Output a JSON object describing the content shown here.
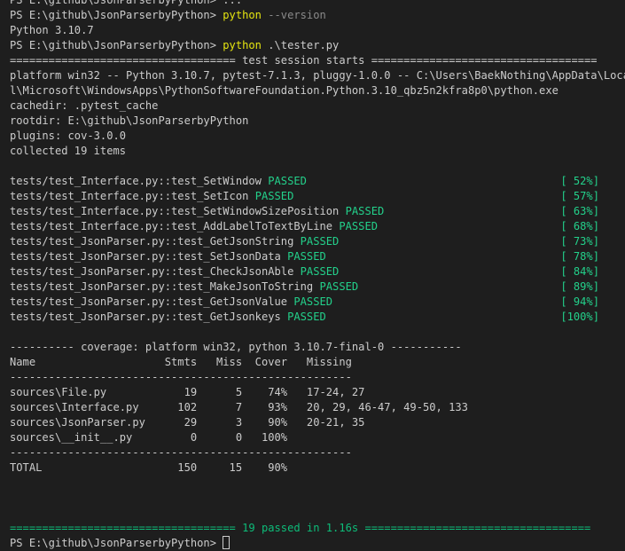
{
  "terminal": {
    "partial_top": "PS E:\\github\\JsonParserbyPython> ...",
    "cmd1": {
      "prompt": "PS E:\\github\\JsonParserbyPython> ",
      "exe": "python",
      "args": " --version"
    },
    "version_output": "Python 3.10.7",
    "cmd2": {
      "prompt": "PS E:\\github\\JsonParserbyPython> ",
      "exe": "python",
      "args": " .\\tester.py"
    },
    "session_header": "=================================== test session starts ===================================",
    "platform_line1": "platform win32 -- Python 3.10.7, pytest-7.1.3, pluggy-1.0.0 -- C:\\Users\\BaekNothing\\AppData\\Local",
    "platform_line2": "l\\Microsoft\\WindowsApps\\PythonSoftwareFoundation.Python.3.10_qbz5n2kfra8p0\\python.exe",
    "cachedir": "cachedir: .pytest_cache",
    "rootdir": "rootdir: E:\\github\\JsonParserbyPython",
    "plugins": "plugins: cov-3.0.0",
    "collected": "collected 19 items",
    "tests": [
      {
        "name": "tests/test_Interface.py::test_SetWindow",
        "status": "PASSED",
        "pct": "[ 52%]"
      },
      {
        "name": "tests/test_Interface.py::test_SetIcon",
        "status": "PASSED",
        "pct": "[ 57%]"
      },
      {
        "name": "tests/test_Interface.py::test_SetWindowSizePosition",
        "status": "PASSED",
        "pct": "[ 63%]"
      },
      {
        "name": "tests/test_Interface.py::test_AddLabelToTextByLine",
        "status": "PASSED",
        "pct": "[ 68%]"
      },
      {
        "name": "tests/test_JsonParser.py::test_GetJsonString",
        "status": "PASSED",
        "pct": "[ 73%]"
      },
      {
        "name": "tests/test_JsonParser.py::test_SetJsonData",
        "status": "PASSED",
        "pct": "[ 78%]"
      },
      {
        "name": "tests/test_JsonParser.py::test_CheckJsonAble",
        "status": "PASSED",
        "pct": "[ 84%]"
      },
      {
        "name": "tests/test_JsonParser.py::test_MakeJsonToString",
        "status": "PASSED",
        "pct": "[ 89%]"
      },
      {
        "name": "tests/test_JsonParser.py::test_GetJsonValue",
        "status": "PASSED",
        "pct": "[ 94%]"
      },
      {
        "name": "tests/test_JsonParser.py::test_GetJsonkeys",
        "status": "PASSED",
        "pct": "[100%]"
      }
    ],
    "coverage_header": "---------- coverage: platform win32, python 3.10.7-final-0 -----------",
    "coverage_columns": "Name                    Stmts   Miss  Cover   Missing",
    "coverage_sep": "-----------------------------------------------------",
    "coverage_rows": [
      "sources\\File.py            19      5    74%   17-24, 27",
      "sources\\Interface.py      102      7    93%   20, 29, 46-47, 49-50, 133",
      "sources\\JsonParser.py      29      3    90%   20-21, 35",
      "sources\\__init__.py         0      0   100%"
    ],
    "coverage_sep2": "-----------------------------------------------------",
    "total": "TOTAL                     150     15    90%",
    "summary": "=================================== 19 passed in 1.16s ===================================",
    "final_prompt": "PS E:\\github\\JsonParserbyPython> "
  },
  "colors": {
    "background": "#1e1e1e",
    "text": "#cccccc",
    "command": "#e5e510",
    "args": "#8a8a8a",
    "passed": "#23d18b"
  }
}
